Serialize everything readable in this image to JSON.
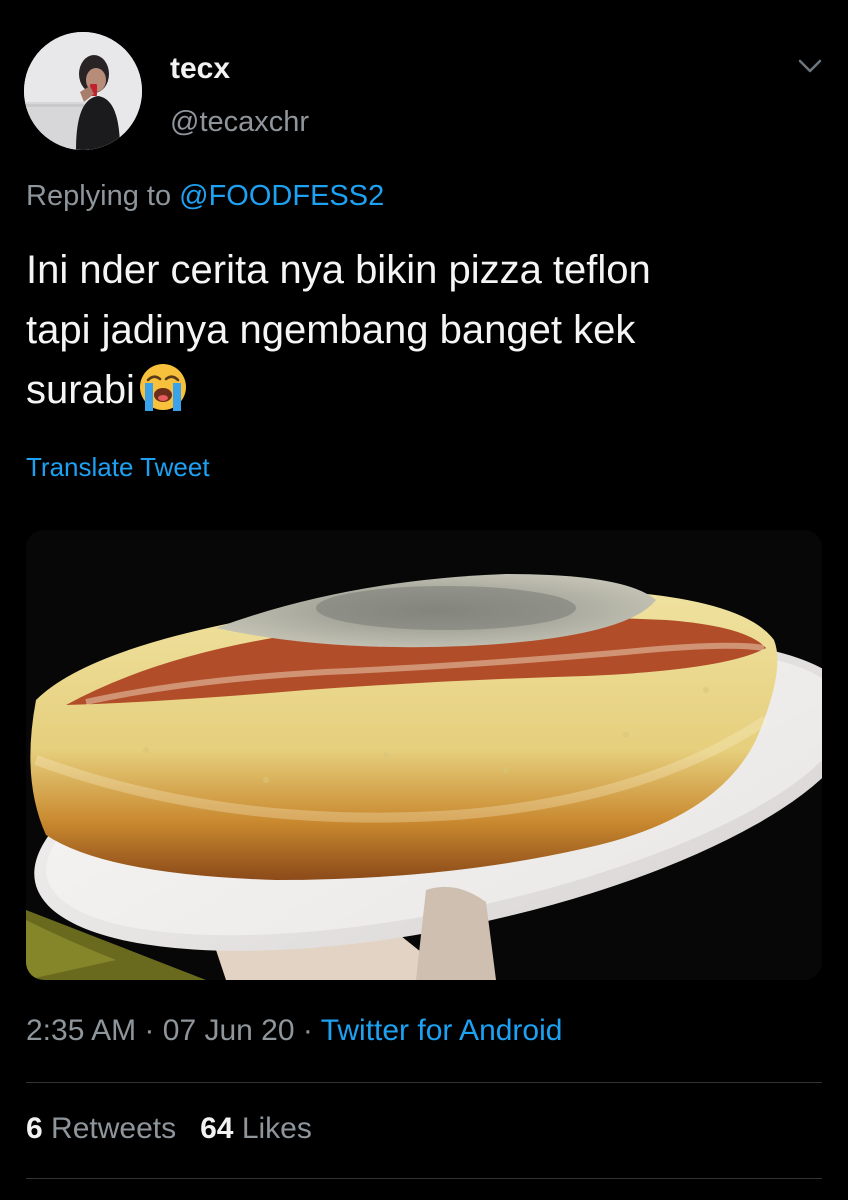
{
  "tweet": {
    "user": {
      "name": "tecx",
      "handle": "@tecaxchr"
    },
    "reply": {
      "prefix": "Replying to",
      "mention": "@FOODFESS2"
    },
    "text_lines": [
      "Ini nder cerita nya bikin pizza teflon",
      "tapi jadinya ngembang banget kek",
      "surabi"
    ],
    "emoji_icon": "loudly-crying-face-icon",
    "translate_label": "Translate Tweet",
    "meta": {
      "time": "2:35 AM",
      "sep": "·",
      "date": "07 Jun 20",
      "source": "Twitter for Android"
    },
    "stats": {
      "retweets_count": "6",
      "retweets_label": "Retweets",
      "likes_count": "64",
      "likes_label": "Likes"
    }
  },
  "colors": {
    "background": "#000000",
    "text": "#f5f5f5",
    "secondary": "#8e959b",
    "accent": "#1da1f2"
  }
}
